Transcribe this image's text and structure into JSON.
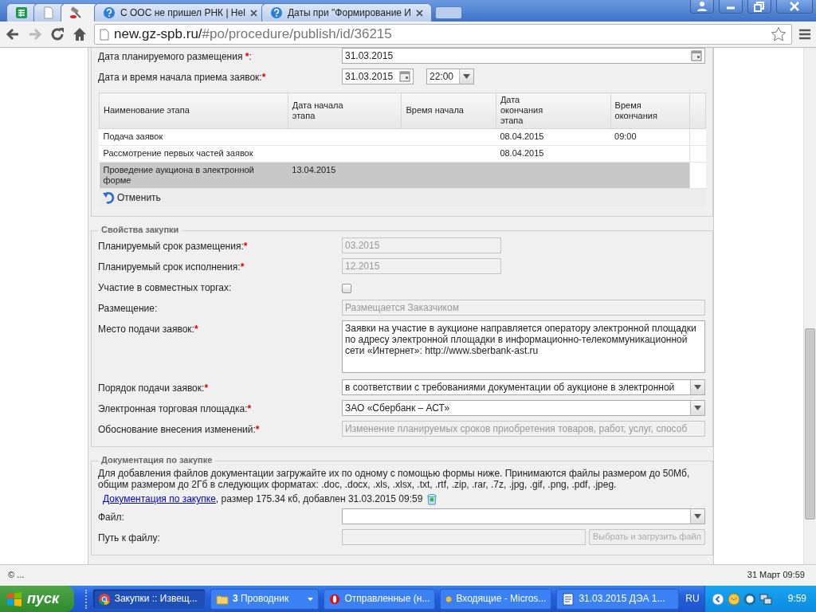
{
  "browser": {
    "tabs": [
      {
        "kind": "sheet",
        "selected": false
      },
      {
        "kind": "doc",
        "selected": false
      },
      {
        "kind": "gavel",
        "selected": true
      },
      {
        "kind": "help",
        "title": "С ООС не пришел РНК | Hel",
        "selected": false
      },
      {
        "kind": "help",
        "title": "Даты при \"Формирование И",
        "selected": false
      }
    ],
    "address": {
      "host": "new.gz-spb.ru/",
      "path": "#po/procedure/publish/id/36215"
    }
  },
  "dates": [
    {
      "kind": "date-wide",
      "label": "Дата планируемого размещения ",
      "required_mark": "*",
      "suffix": ":",
      "value": "31.03.2015"
    },
    {
      "kind": "date-time",
      "label": "Дата и время начала приема заявок:",
      "required_mark": "*",
      "value": "31.03.2015",
      "time": "22:00"
    }
  ],
  "stages": {
    "columns": [
      "Наименование этапа",
      "Дата начала этапа",
      "Время начала",
      "Дата окончания этапа",
      "Время окончания"
    ],
    "rows": [
      {
        "name": "Подача заявок",
        "end_date": "08.04.2015",
        "end_time": "09:00",
        "selected": false
      },
      {
        "name": "Рассмотрение первых частей заявок",
        "end_date": "08.04.2015",
        "selected": false
      },
      {
        "name": "Проведение аукциона в электронной форме",
        "start_date": "13.04.2015",
        "selected": true
      }
    ],
    "undo": "Отменить"
  },
  "properties": {
    "title": "Свойства закупки",
    "fields": [
      {
        "kind": "readonly-short",
        "label": "Планируемый срок размещения:",
        "required_mark": "*",
        "value": "03.2015"
      },
      {
        "kind": "readonly-short",
        "label": "Планируемый срок исполнения:",
        "required_mark": "*",
        "value": "12.2015"
      },
      {
        "kind": "checkbox",
        "label": "Участие в совместных торгах:",
        "checked": false
      },
      {
        "kind": "readonly",
        "label": "Размещение:",
        "value": "Размещается Заказчиком"
      },
      {
        "kind": "textarea",
        "label": "Место подачи заявок:",
        "required_mark": "*",
        "value": "Заявки на участие в аукционе направляется оператору электронной площадки по адресу электронной площадки в информационно-телекоммуникационной сети «Интернет»: http://www.sberbank-ast.ru"
      },
      {
        "kind": "select",
        "label": "Порядок подачи заявок:",
        "required_mark": "*",
        "value": "в соответствии с требованиями документации об аукционе в электронной"
      },
      {
        "kind": "select",
        "label": "Электронная торговая площадка:",
        "required_mark": "*",
        "value": "ЗАО «Сбербанк – АСТ»"
      },
      {
        "kind": "readonly",
        "label": "Обоснование внесения изменений:",
        "required_mark": "*",
        "value": "Изменение планируемых сроков приобретения товаров, работ, услуг, способ"
      }
    ]
  },
  "documents": {
    "title": "Документация по закупке",
    "description": "Для добавления файлов документации загружайте их по одному с помощью формы ниже. Принимаются файлы размером до 50Мб, общим размером до 2Гб в следующих форматах: .doc, .docx, .xls, .xlsx, .txt, .rtf, .zip, .rar, .7z, .jpg, .gif, .png, .pdf, .jpeg.",
    "file": {
      "link": "Документация по закупке",
      "info": ", размер 175.34 кб, добавлен 31.03.2015 09:59"
    },
    "fields": [
      {
        "kind": "select",
        "label": "Файл:"
      },
      {
        "kind": "file",
        "label": "Путь к файлу:",
        "button": "Выбрать и загрузить файл"
      }
    ]
  },
  "footer": {
    "left": "© ...",
    "right": "31 Март 09:59"
  },
  "taskbar": {
    "start": "пуск",
    "items": [
      {
        "kind": "chrome",
        "label": "Закупки :: Извещ...",
        "selected": true
      },
      {
        "kind": "folder",
        "label": "**3** Проводник",
        "group": true,
        "selected": false
      },
      {
        "kind": "opera",
        "label": "Отправленные (н...",
        "selected": false
      },
      {
        "kind": "mail",
        "label": "Входящие - Micros...",
        "selected": false
      },
      {
        "kind": "word",
        "label": "31.03.2015 ДЭА 1...",
        "selected": false
      }
    ],
    "language": "RU",
    "clock": "9:59"
  }
}
